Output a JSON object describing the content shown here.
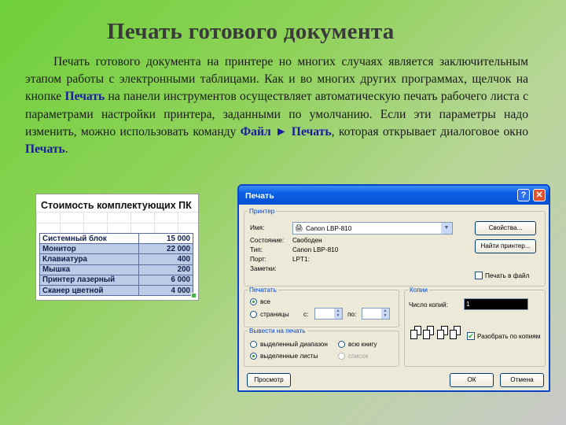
{
  "slide": {
    "title": "Печать готового документа",
    "para": {
      "t1": "Печать готового документа на принтере но многих случаях является заключительным этапом работы с электронными таблицами. Как и во многих других программах, щелчок на кнопке ",
      "k1": "Печать",
      "t2": " на панели инструментов осуществляет автоматическую печать рабочего листа с параметрами настройки принтера, заданными по умолчанию. Если эти параметры надо изменить, можно использовать команду ",
      "k2": "Файл ► Печать",
      "t3": ", которая открывает диалоговое окно ",
      "k3": "Печать",
      "t4": "."
    }
  },
  "sheet": {
    "title": "Стоимость комплектующих ПК",
    "rows": [
      {
        "name": "Системный блок",
        "value": "15 000"
      },
      {
        "name": "Монитор",
        "value": "22 000"
      },
      {
        "name": "Клавиатура",
        "value": "400"
      },
      {
        "name": "Мышка",
        "value": "200"
      },
      {
        "name": "Принтер лазерный",
        "value": "6 000"
      },
      {
        "name": "Сканер цветной",
        "value": "4 000"
      }
    ]
  },
  "dialog": {
    "title": "Печать",
    "help": "?",
    "close": "✕",
    "printer": {
      "legend": "Принтер",
      "name_label": "Имя:",
      "name_value": "Canon LBP-810",
      "status_label": "Состояние:",
      "status_value": "Свободен",
      "type_label": "Тип:",
      "type_value": "Canon LBP-810",
      "port_label": "Порт:",
      "port_value": "LPT1:",
      "notes_label": "Заметки:",
      "properties_btn": "Свойства...",
      "find_btn": "Найти принтер...",
      "print_to_file": "Печать в файл"
    },
    "range": {
      "legend": "Печатать",
      "all": "все",
      "pages": "страницы",
      "from": "с:",
      "to": "по:"
    },
    "copies": {
      "legend": "Копии",
      "count_label": "Число копий:",
      "count_value": "1",
      "collate": "Разобрать по копиям"
    },
    "output": {
      "legend": "Вывести на печать",
      "selection": "выделенный диапазон",
      "workbook": "всю книгу",
      "sheets": "выделенные листы",
      "list": "список"
    },
    "preview_btn": "Просмотр",
    "ok_btn": "ОК",
    "cancel_btn": "Отмена"
  }
}
